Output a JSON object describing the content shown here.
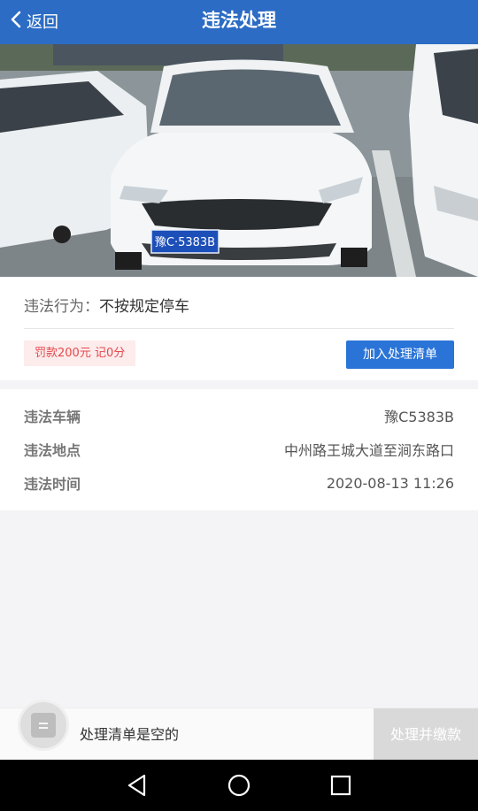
{
  "header": {
    "back_label": "返回",
    "title": "违法处理"
  },
  "photo": {
    "plate_text": "豫C·5383B"
  },
  "violation": {
    "behavior_key": "违法行为：",
    "behavior_value": "不按规定停车",
    "penalty": "罚款200元 记0分",
    "add_button": "加入处理清单"
  },
  "details": [
    {
      "label": "违法车辆",
      "value": "豫C5383B"
    },
    {
      "label": "违法地点",
      "value": "中州路王城大道至涧东路口"
    },
    {
      "label": "违法时间",
      "value": "2020-08-13 11:26"
    }
  ],
  "bottom": {
    "cart_status": "处理清单是空的",
    "pay_button": "处理并缴款"
  },
  "nav": {
    "icons": [
      "back-triangle-icon",
      "home-circle-icon",
      "recents-square-icon"
    ]
  },
  "colors": {
    "header": "#2c6cc4",
    "primary_button": "#2a74d8",
    "penalty_text": "#e5484d",
    "penalty_bg": "#fdecec",
    "disabled_button": "#d9d9d9"
  }
}
